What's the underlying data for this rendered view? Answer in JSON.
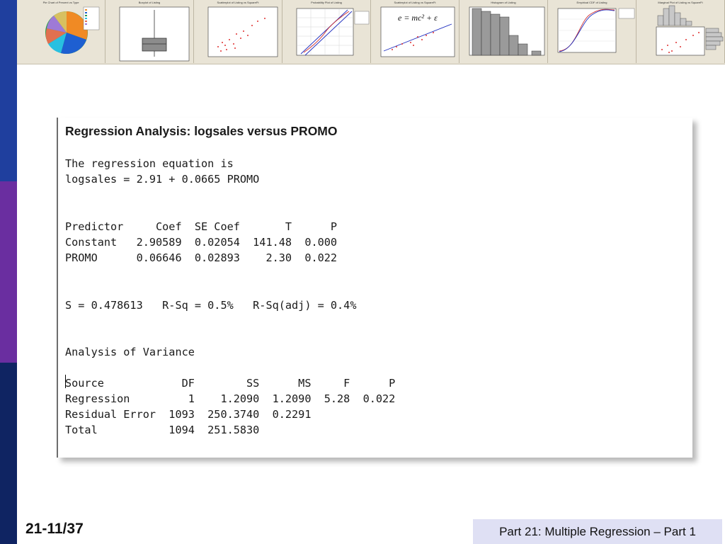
{
  "thumbnails": [
    {
      "title": "Pie Chart of Percent vs Type",
      "icon": "pie-chart-thumb-icon"
    },
    {
      "title": "Boxplot of Listing",
      "icon": "boxplot-thumb-icon"
    },
    {
      "title": "Scatterplot of Listing vs SquareFt",
      "icon": "scatterplot-thumb-icon"
    },
    {
      "title": "Probability Plot of Listing",
      "icon": "probability-plot-thumb-icon"
    },
    {
      "title": "Scatterplot of Listing vs SquareFt",
      "icon": "regression-line-thumb-icon",
      "equation": "e = mc² + ε"
    },
    {
      "title": "Histogram of Listing",
      "icon": "histogram-thumb-icon"
    },
    {
      "title": "Empirical CDF of Listing",
      "icon": "empirical-cdf-thumb-icon"
    },
    {
      "title": "Marginal Plot of Listing vs SquareFt",
      "icon": "marginal-plot-thumb-icon"
    }
  ],
  "output": {
    "title": "Regression Analysis: logsales versus PROMO",
    "equation_intro": "The regression equation is",
    "equation": "logsales = 2.91 + 0.0665 PROMO",
    "coef_header": "Predictor     Coef  SE Coef       T      P",
    "coef_rows": [
      "Constant   2.90589  0.02054  141.48  0.000",
      "PROMO      0.06646  0.02893    2.30  0.022"
    ],
    "fit_stats": "S = 0.478613   R-Sq = 0.5%   R-Sq(adj) = 0.4%",
    "anova_title": "Analysis of Variance",
    "anova_header": "Source            DF        SS      MS     F      P",
    "anova_rows": [
      "Regression         1    1.2090  1.2090  5.28  0.022",
      "Residual Error  1093  250.3740  0.2291",
      "Total           1094  251.5830"
    ]
  },
  "footer": {
    "slide_number": "21-11/37",
    "caption": "Part 21: Multiple Regression – Part 1"
  }
}
